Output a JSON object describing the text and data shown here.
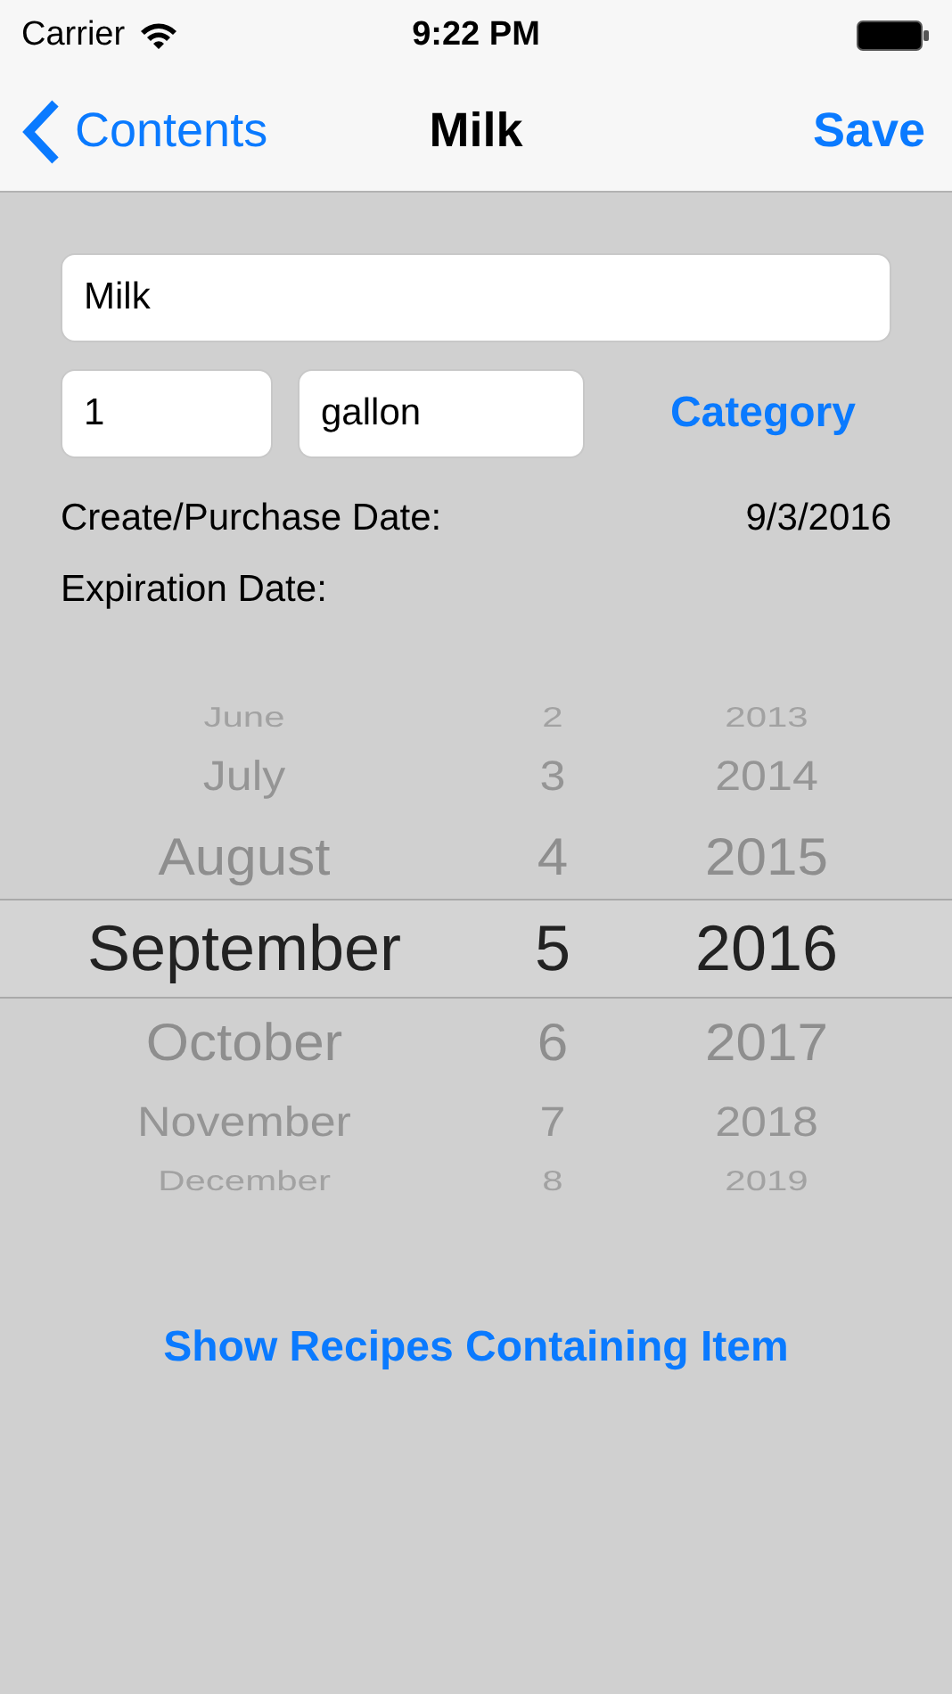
{
  "status_bar": {
    "carrier": "Carrier",
    "time": "9:22 PM"
  },
  "nav_bar": {
    "back": "Contents",
    "title": "Milk",
    "action": "Save"
  },
  "form": {
    "name": {
      "value": "Milk"
    },
    "quantity": {
      "value": "1"
    },
    "unit": {
      "value": "gallon"
    },
    "category_button": "Category",
    "create_label": "Create/Purchase Date:",
    "create_value": "9/3/2016",
    "expiration_label": "Expiration Date:"
  },
  "date_picker": {
    "rows": [
      {
        "month": "June",
        "day": "2",
        "year": "2013",
        "selected": false
      },
      {
        "month": "July",
        "day": "3",
        "year": "2014",
        "selected": false
      },
      {
        "month": "August",
        "day": "4",
        "year": "2015",
        "selected": false
      },
      {
        "month": "September",
        "day": "5",
        "year": "2016",
        "selected": true
      },
      {
        "month": "October",
        "day": "6",
        "year": "2017",
        "selected": false
      },
      {
        "month": "November",
        "day": "7",
        "year": "2018",
        "selected": false
      },
      {
        "month": "December",
        "day": "8",
        "year": "2019",
        "selected": false
      }
    ]
  },
  "recipes_button": "Show Recipes Containing Item"
}
